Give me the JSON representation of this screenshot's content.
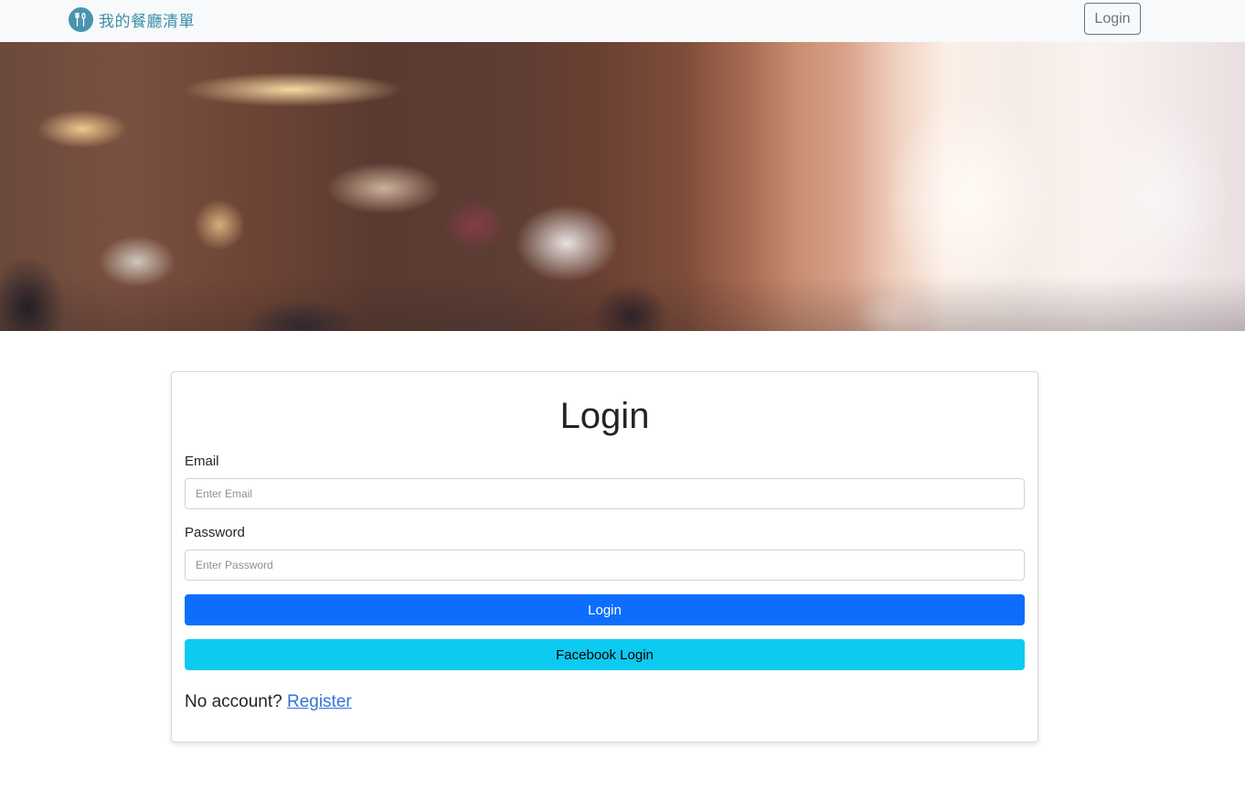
{
  "navbar": {
    "brand_text": "我的餐廳清單",
    "brand_icon": "fork-knife-icon",
    "login_label": "Login"
  },
  "banner": {
    "image": "blurred-restaurant-interior"
  },
  "login_card": {
    "title": "Login",
    "email_label": "Email",
    "email_placeholder": "Enter Email",
    "email_value": "",
    "password_label": "Password",
    "password_placeholder": "Enter Password",
    "password_value": "",
    "login_button": "Login",
    "facebook_button": "Facebook Login",
    "no_account_text": "No account?",
    "register_link": "Register"
  },
  "colors": {
    "navbar_bg": "#f8f9fa",
    "brand": "#3d8fab",
    "primary": "#0d6efd",
    "info": "#0dcaf0",
    "link": "#3374d6"
  }
}
